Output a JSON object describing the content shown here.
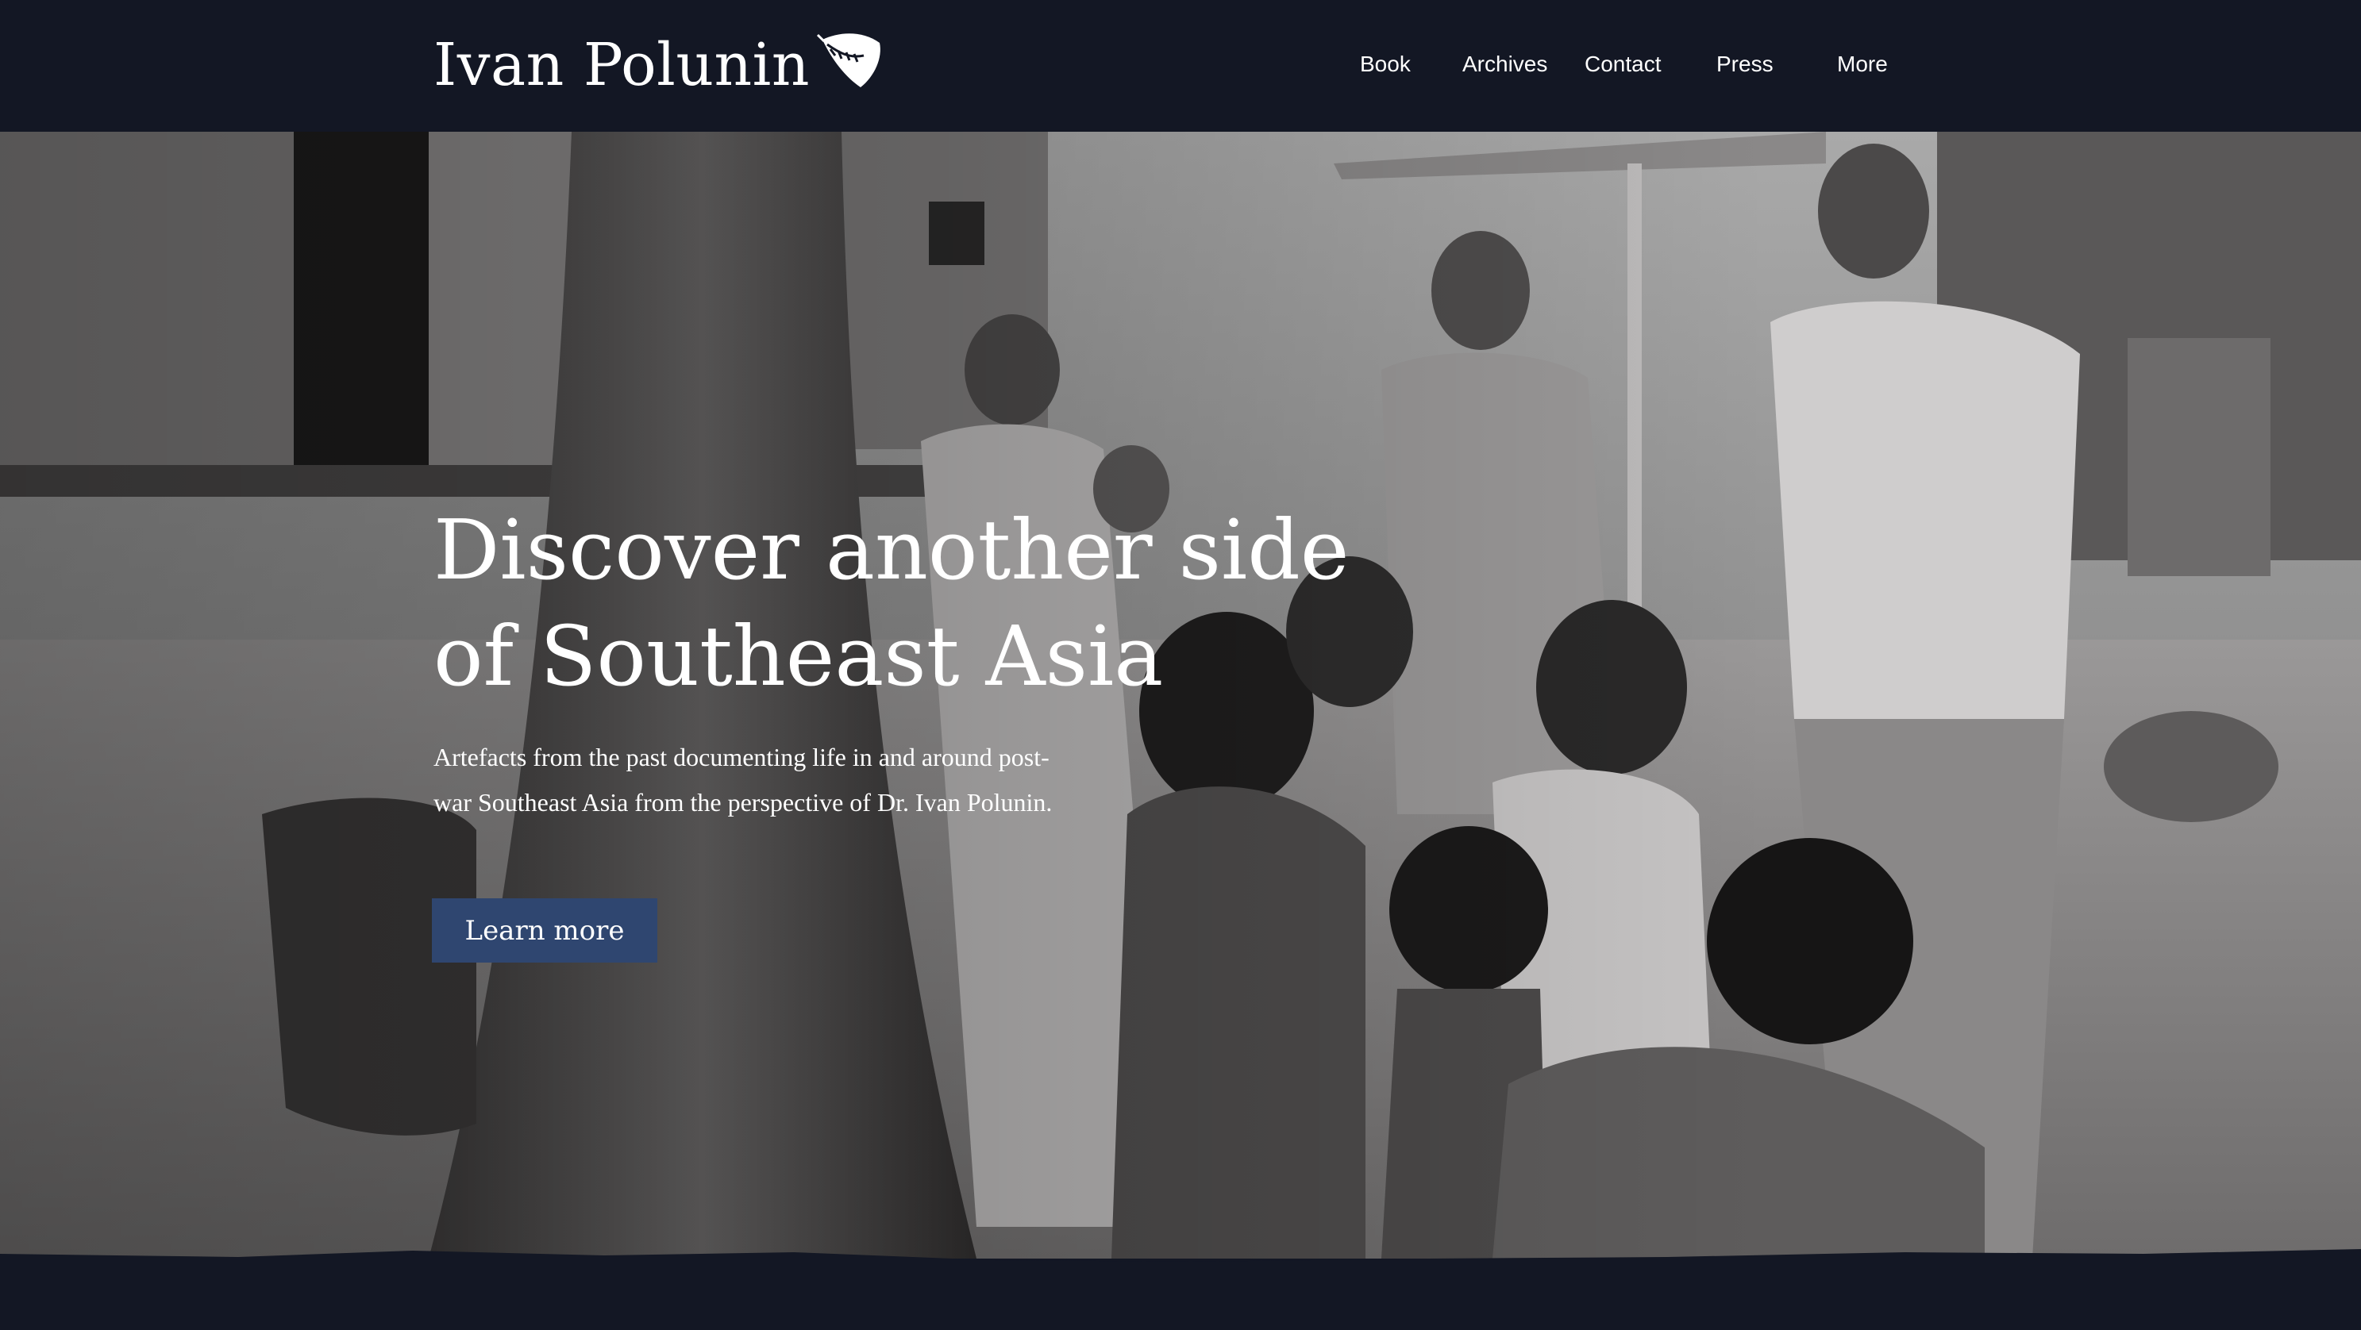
{
  "header": {
    "logo_text": "Ivan Polunin",
    "logo_icon": "moth-icon"
  },
  "nav": {
    "items": [
      "Book",
      "Archives",
      "Contact",
      "Press",
      "More"
    ]
  },
  "hero": {
    "headline_line1": "Discover another side",
    "headline_line2": "of Southeast Asia",
    "description": "Artefacts from the past documenting life in and around post-war Southeast Asia from the perspective of Dr. Ivan Polunin.",
    "cta_label": "Learn more",
    "image": "black-and-white-photo-villagers-on-beach"
  },
  "colors": {
    "background": "#131724",
    "text": "#ffffff",
    "button": "#2f4670"
  }
}
